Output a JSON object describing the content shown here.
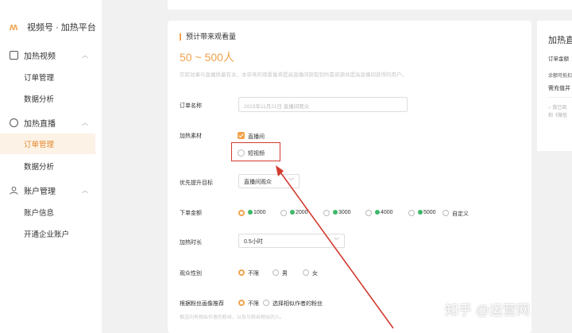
{
  "app": {
    "brand": "视频号 · 加热平台"
  },
  "sidebar": {
    "groups": [
      {
        "label": "加热视频",
        "items": [
          "订单管理",
          "数据分析"
        ]
      },
      {
        "label": "加热直播",
        "items": [
          "订单管理",
          "数据分析"
        ]
      },
      {
        "label": "账户管理",
        "items": [
          "账户信息",
          "开通企业账户"
        ]
      }
    ],
    "active_item": "加热直播/订单管理"
  },
  "form": {
    "estimate_title": "预计带来观看量",
    "estimate_value": "50 ~ 500人",
    "estimate_note": "实际效果与直播质量有关，本带来的观看量将提高直播间获取到所需资源并提高直播间获得的用户。",
    "order_name_label": "订单名称",
    "order_name_placeholder": "2023年11月21日 直播间观众",
    "material_label": "加热素材",
    "material_options": [
      "直播间",
      "短视频"
    ],
    "target_label": "优先提升目标",
    "target_value": "直播间观众",
    "amount_label": "下单金额",
    "amount_options": [
      "1000",
      "2000",
      "3000",
      "4000",
      "5000",
      "自定义"
    ],
    "duration_label": "加热时长",
    "duration_value": "0.5小时",
    "gender_label": "观众性别",
    "gender_options": [
      "不限",
      "男",
      "女"
    ],
    "fans_label": "根据粉丝画像推荐",
    "fans_options": [
      "不限",
      "选择相似作者的粉丝"
    ],
    "fans_note": "推送向有相似作者的粉丝，以及与粉丝相似的人。"
  },
  "right_panel": {
    "title": "加热直",
    "line1": "订单金额",
    "line2": "余额可抵扣",
    "line3": "需充值并",
    "line4": "我已阅",
    "line5": "和《微信"
  },
  "watermark": "知乎 @运营网",
  "colors": {
    "accent": "#f0a34c",
    "highlight": "#d23b2e",
    "coin": "#3eb86a"
  }
}
